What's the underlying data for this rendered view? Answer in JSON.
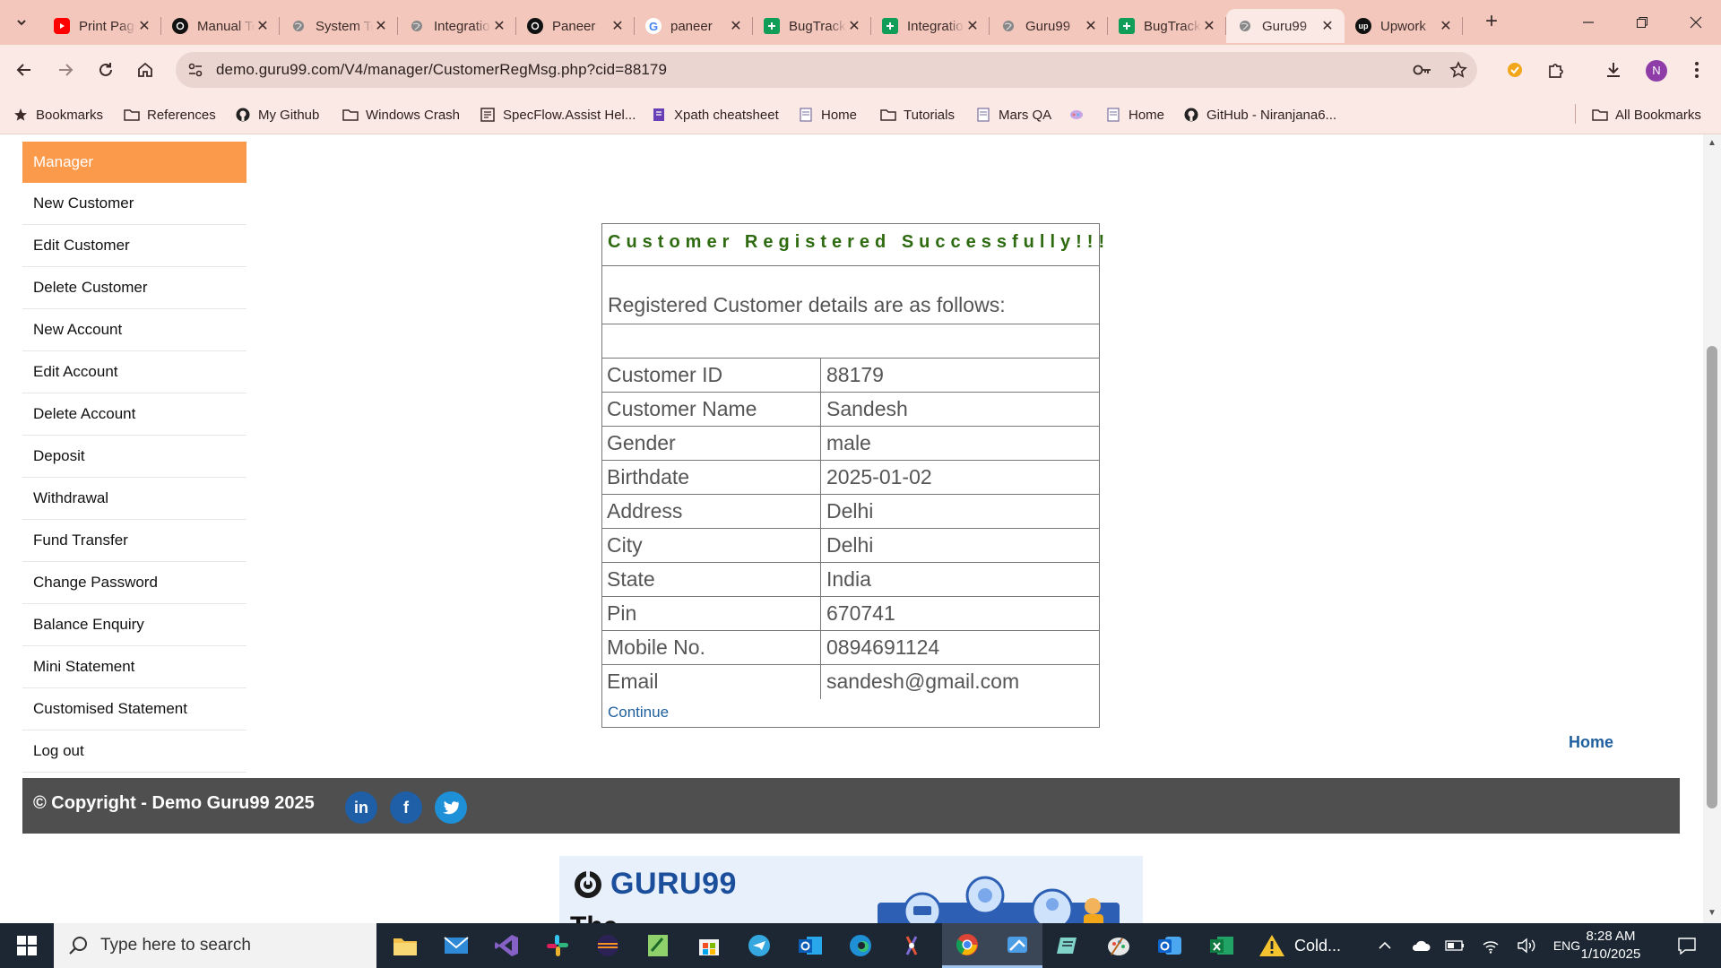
{
  "browser": {
    "tabs": [
      {
        "title": "Print Page",
        "icon": "youtube-icon",
        "color": "#ff0000"
      },
      {
        "title": "Manual Testing",
        "icon": "github-icon",
        "color": "#111111"
      },
      {
        "title": "System Testing",
        "icon": "globe-icon",
        "color": "#555555"
      },
      {
        "title": "Integration",
        "icon": "globe-icon",
        "color": "#555555"
      },
      {
        "title": "Paneer",
        "icon": "chatgpt-icon",
        "color": "#111111"
      },
      {
        "title": "paneer",
        "icon": "google-icon",
        "color": "#4285f4"
      },
      {
        "title": "BugTracker",
        "icon": "sheets-icon",
        "color": "#0f9d58"
      },
      {
        "title": "Integration",
        "icon": "sheets-icon",
        "color": "#0f9d58"
      },
      {
        "title": "Guru99",
        "icon": "globe-icon",
        "color": "#555555"
      },
      {
        "title": "BugTracker",
        "icon": "sheets-icon",
        "color": "#0f9d58"
      },
      {
        "title": "Guru99",
        "icon": "globe-icon",
        "color": "#555555",
        "active": true
      },
      {
        "title": "Upwork",
        "icon": "upwork-icon",
        "color": "#111111"
      }
    ],
    "url": "demo.guru99.com/V4/manager/CustomerRegMsg.php?cid=88179",
    "profile_initial": "N",
    "bookmarks": [
      {
        "label": "Bookmarks",
        "icon": "star-icon"
      },
      {
        "label": "References",
        "icon": "folder-icon"
      },
      {
        "label": "My Github",
        "icon": "github-icon"
      },
      {
        "label": "Windows Crash",
        "icon": "folder-icon"
      },
      {
        "label": "SpecFlow.Assist Hel...",
        "icon": "doc-icon"
      },
      {
        "label": "Xpath cheatsheet",
        "icon": "page-icon"
      },
      {
        "label": "Home",
        "icon": "page-icon"
      },
      {
        "label": "Tutorials",
        "icon": "folder-icon"
      },
      {
        "label": "Mars QA",
        "icon": "page-icon"
      },
      {
        "label": "",
        "icon": "app-icon"
      },
      {
        "label": "Home",
        "icon": "page-icon"
      },
      {
        "label": "GitHub - Niranjana6...",
        "icon": "github-icon"
      }
    ],
    "all_bookmarks": "All Bookmarks"
  },
  "sidebar": {
    "header": "Manager",
    "items": [
      "New Customer",
      "Edit Customer",
      "Delete Customer",
      "New Account",
      "Edit Account",
      "Delete Account",
      "Deposit",
      "Withdrawal",
      "Fund Transfer",
      "Change Password",
      "Balance Enquiry",
      "Mini Statement",
      "Customised Statement",
      "Log out"
    ]
  },
  "result": {
    "title": "Customer Registered Successfully!!!",
    "subtitle": "Registered Customer details are as follows:",
    "rows": [
      {
        "label": "Customer ID",
        "value": "88179"
      },
      {
        "label": "Customer Name",
        "value": "Sandesh"
      },
      {
        "label": "Gender",
        "value": "male"
      },
      {
        "label": "Birthdate",
        "value": "2025-01-02"
      },
      {
        "label": "Address",
        "value": "Delhi"
      },
      {
        "label": "City",
        "value": "Delhi"
      },
      {
        "label": "State",
        "value": "India"
      },
      {
        "label": "Pin",
        "value": "670741"
      },
      {
        "label": "Mobile No.",
        "value": "0894691124"
      },
      {
        "label": "Email",
        "value": "sandesh@gmail.com"
      }
    ],
    "continue_label": "Continue"
  },
  "home_link": "Home",
  "footer": {
    "copyright": "© Copyright - Demo Guru99 2025",
    "social": [
      "linkedin-icon",
      "facebook-icon",
      "twitter-icon"
    ]
  },
  "ad": {
    "brand": "GURU99",
    "headline": "The"
  },
  "taskbar": {
    "search_placeholder": "Type here to search",
    "weather": "Cold...",
    "language": "ENG",
    "time": "8:28 AM",
    "date": "1/10/2025"
  },
  "colors": {
    "menu_header": "#fb9a4b",
    "success_text": "#2e6b10",
    "link": "#1f5f9e",
    "footer_bg": "#4f4f4f",
    "tab_strip": "#f4c7bd"
  }
}
